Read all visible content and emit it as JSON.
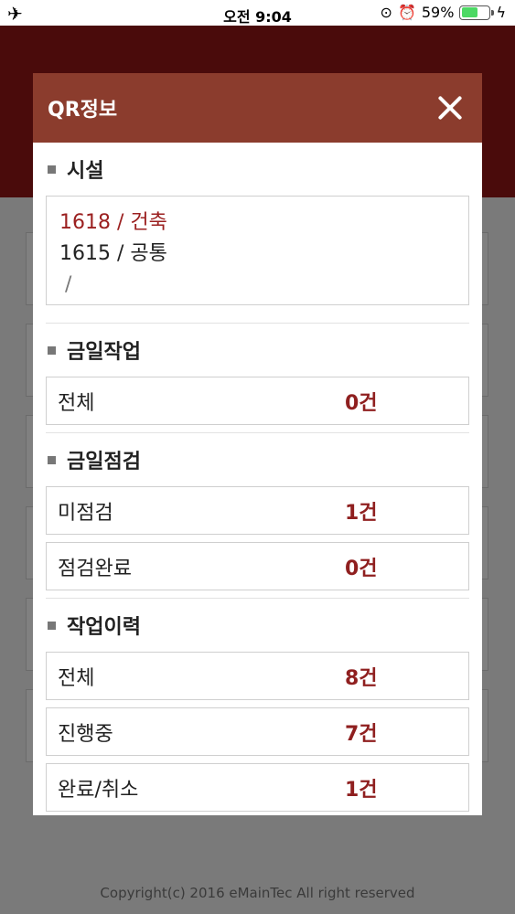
{
  "status_bar": {
    "left_icon": "airplane-icon",
    "time": "오전 9:04",
    "battery_percent": "59%",
    "battery_level": 0.59,
    "icons": [
      "orientation-lock-icon",
      "alarm-icon",
      "battery-icon",
      "charging-icon"
    ]
  },
  "background": {
    "copyright": "Copyright(c) 2016 eMainTec All right reserved"
  },
  "modal": {
    "title": "QR정보",
    "close_icon": "close-icon",
    "sections": {
      "facility": {
        "title": "시설",
        "lines": [
          "1618 / 건축",
          "1615 / 공통",
          "/"
        ]
      },
      "today_work": {
        "title": "금일작업",
        "rows": [
          {
            "label": "전체",
            "value": "0건"
          }
        ]
      },
      "today_inspection": {
        "title": "금일점검",
        "rows": [
          {
            "label": "미점검",
            "value": "1건"
          },
          {
            "label": "점검완료",
            "value": "0건"
          }
        ]
      },
      "work_history": {
        "title": "작업이력",
        "rows": [
          {
            "label": "전체",
            "value": "8건"
          },
          {
            "label": "진행중",
            "value": "7건"
          },
          {
            "label": "완료/취소",
            "value": "1건"
          }
        ]
      }
    }
  },
  "colors": {
    "header_bg": "#8b3c2d",
    "accent_value": "#8f1f1f",
    "facility_active": "#9b2020"
  }
}
